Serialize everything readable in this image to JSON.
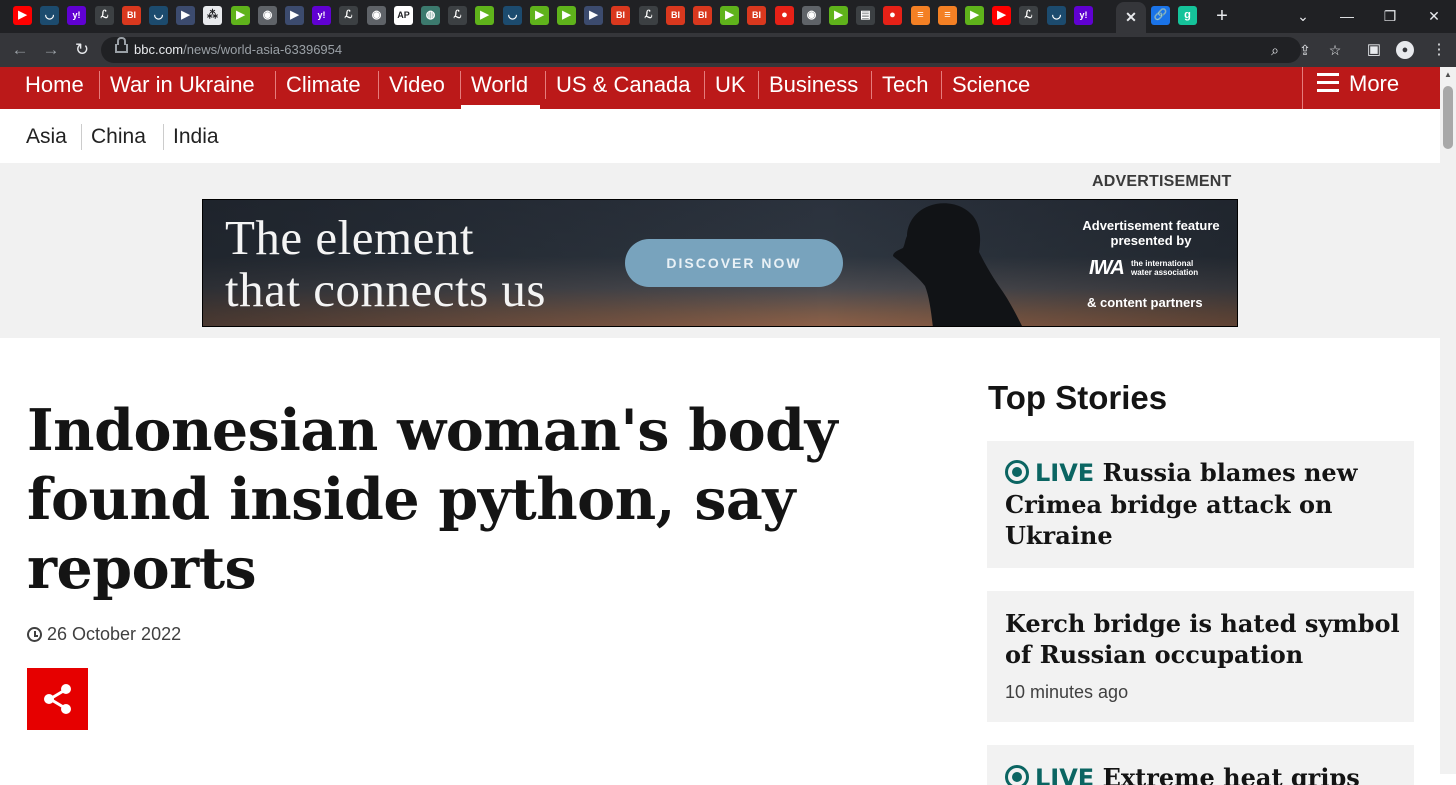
{
  "browser": {
    "tabs": [
      {
        "icon": "youtube-icon",
        "color": "#ff0000",
        "glyph": "▶"
      },
      {
        "icon": "shield-icon",
        "color": "#1c4b6e",
        "glyph": "◡"
      },
      {
        "icon": "yahoo-icon",
        "color": "#6001d2",
        "glyph": "y!"
      },
      {
        "icon": "la-times-icon",
        "color": "#202124",
        "glyph": "ℒ"
      },
      {
        "icon": "business-insider-icon",
        "color": "#d9381e",
        "glyph": "BI"
      },
      {
        "icon": "shield-icon",
        "color": "#1c4b6e",
        "glyph": "◡"
      },
      {
        "icon": "arrow-icon",
        "color": "#3c4b6e",
        "glyph": "▶"
      },
      {
        "icon": "puzzle-icon",
        "color": "#e8eaed",
        "glyph": "⁂"
      },
      {
        "icon": "play-green-icon",
        "color": "#5fb31b",
        "glyph": "▶"
      },
      {
        "icon": "globe-icon",
        "color": "#5f6368",
        "glyph": "◉"
      },
      {
        "icon": "arrow-icon",
        "color": "#3c4b6e",
        "glyph": "▶"
      },
      {
        "icon": "yahoo-icon",
        "color": "#6001d2",
        "glyph": "y!"
      },
      {
        "icon": "la-times-icon",
        "color": "#202124",
        "glyph": "ℒ"
      },
      {
        "icon": "globe-icon",
        "color": "#5f6368",
        "glyph": "◉"
      },
      {
        "icon": "ap-icon",
        "color": "#ffffff",
        "glyph": "AP"
      },
      {
        "icon": "starbucks-icon",
        "color": "#3c7a6e",
        "glyph": "◍"
      },
      {
        "icon": "la-times-icon",
        "color": "#202124",
        "glyph": "ℒ"
      },
      {
        "icon": "play-green-icon",
        "color": "#5fb31b",
        "glyph": "▶"
      },
      {
        "icon": "shield-icon",
        "color": "#1c4b6e",
        "glyph": "◡"
      },
      {
        "icon": "play-green-icon",
        "color": "#5fb31b",
        "glyph": "▶"
      },
      {
        "icon": "play-green-icon",
        "color": "#5fb31b",
        "glyph": "▶"
      },
      {
        "icon": "arrow-icon",
        "color": "#3c4b6e",
        "glyph": "▶"
      },
      {
        "icon": "business-insider-icon",
        "color": "#d9381e",
        "glyph": "BI"
      },
      {
        "icon": "la-times-icon",
        "color": "#202124",
        "glyph": "ℒ"
      },
      {
        "icon": "business-insider-icon",
        "color": "#d9381e",
        "glyph": "BI"
      },
      {
        "icon": "business-insider-icon",
        "color": "#d9381e",
        "glyph": "BI"
      },
      {
        "icon": "play-green-icon",
        "color": "#5fb31b",
        "glyph": "▶"
      },
      {
        "icon": "business-insider-icon",
        "color": "#d9381e",
        "glyph": "BI"
      },
      {
        "icon": "podcast-red-icon",
        "color": "#e62117",
        "glyph": "●"
      },
      {
        "icon": "globe-icon",
        "color": "#5f6368",
        "glyph": "◉"
      },
      {
        "icon": "play-green-icon",
        "color": "#5fb31b",
        "glyph": "▶"
      },
      {
        "icon": "news-icon",
        "color": "#2b2b2b",
        "glyph": "▤"
      },
      {
        "icon": "podcast-red-icon",
        "color": "#e62117",
        "glyph": "●"
      },
      {
        "icon": "stack-orange-icon",
        "color": "#f48024",
        "glyph": "≡"
      },
      {
        "icon": "stack-orange-icon",
        "color": "#f48024",
        "glyph": "≡"
      },
      {
        "icon": "play-green-icon",
        "color": "#5fb31b",
        "glyph": "▶"
      },
      {
        "icon": "youtube-icon",
        "color": "#ff0000",
        "glyph": "▶"
      },
      {
        "icon": "la-times-icon",
        "color": "#202124",
        "glyph": "ℒ"
      },
      {
        "icon": "shield-icon",
        "color": "#1c4b6e",
        "glyph": "◡"
      },
      {
        "icon": "yahoo-icon",
        "color": "#6001d2",
        "glyph": "y!"
      }
    ],
    "tail_tabs": [
      {
        "icon": "link-icon",
        "color": "#1a73e8",
        "glyph": "🔗"
      },
      {
        "icon": "grammarly-icon",
        "color": "#15c39a",
        "glyph": "g"
      }
    ],
    "active_tab_close": "✕",
    "new_tab": "+",
    "url_host": "bbc.com",
    "url_path": "/news/world-asia-63396954"
  },
  "nav": {
    "items": [
      {
        "label": "Home",
        "selected": false
      },
      {
        "label": "War in Ukraine",
        "selected": false
      },
      {
        "label": "Climate",
        "selected": false
      },
      {
        "label": "Video",
        "selected": false
      },
      {
        "label": "World",
        "selected": true
      },
      {
        "label": "US & Canada",
        "selected": false
      },
      {
        "label": "UK",
        "selected": false
      },
      {
        "label": "Business",
        "selected": false
      },
      {
        "label": "Tech",
        "selected": false
      },
      {
        "label": "Science",
        "selected": false
      }
    ],
    "more_label": "More"
  },
  "subnav": {
    "items": [
      {
        "label": "Asia",
        "selected": true
      },
      {
        "label": "China",
        "selected": false
      },
      {
        "label": "India",
        "selected": false
      }
    ]
  },
  "ad": {
    "label": "ADVERTISEMENT",
    "headline_line1": "The element",
    "headline_line2": "that connects us",
    "cta": "DISCOVER NOW",
    "feature_line1": "Advertisement feature",
    "feature_line2": "presented by",
    "sponsor_logo": "IWA",
    "sponsor_name_line1": "the international",
    "sponsor_name_line2": "water association",
    "partners": "& content partners"
  },
  "article": {
    "title": "Indonesian woman's body found inside python, say reports",
    "date": "26 October 2022"
  },
  "top_stories": {
    "heading": "Top Stories",
    "stories": [
      {
        "live_label": "LIVE",
        "headline": "Russia blames new Crimea bridge attack on Ukraine"
      },
      {
        "headline": "Kerch bridge is hated symbol of Russian occupation",
        "time": "10 minutes ago"
      },
      {
        "live_label": "LIVE",
        "headline": "Extreme heat grips"
      }
    ]
  },
  "colors": {
    "bbc_red": "#bb1919",
    "live_teal": "#0b6562",
    "share_red": "#e60000"
  }
}
